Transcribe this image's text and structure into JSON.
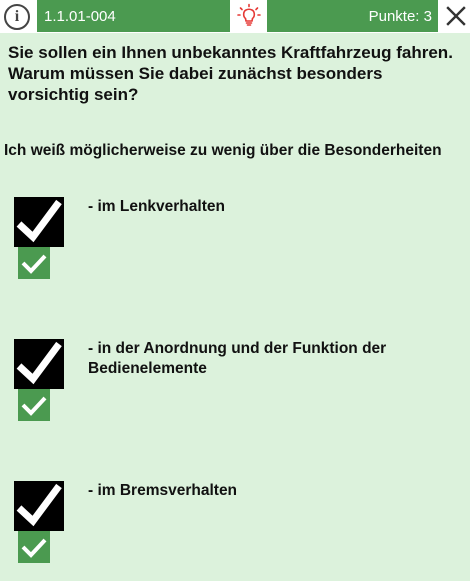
{
  "header": {
    "info_icon": "info-icon",
    "info_glyph": "i",
    "question_id": "1.1.01-004",
    "hint_icon": "lightbulb-icon",
    "points": "Punkte: 3",
    "close_icon": "close-icon"
  },
  "question": {
    "text": "Sie sollen ein Ihnen unbekanntes Kraftfahrzeug fahren. Warum müssen Sie dabei zunächst besonders vorsichtig sein?",
    "intro": "Ich weiß möglicherweise zu wenig über die Besonderheiten"
  },
  "answers": [
    {
      "text": "- im Lenkverhalten",
      "checked": true,
      "correct": true
    },
    {
      "text": "- in der Anordnung und der Funktion der Bedienelemente",
      "checked": true,
      "correct": true
    },
    {
      "text": "- im Bremsverhalten",
      "checked": true,
      "correct": true
    }
  ],
  "colors": {
    "background": "#dcf2dc",
    "accent_green": "#4b9a50",
    "hint_red": "#e53935"
  }
}
